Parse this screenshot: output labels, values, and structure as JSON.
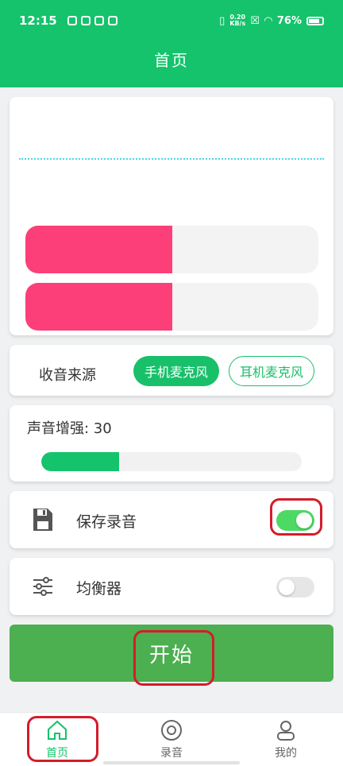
{
  "status_bar": {
    "time": "12:15",
    "net_speed_value": "0.20",
    "net_speed_unit": "KB/s",
    "battery": "76%"
  },
  "header": {
    "title": "首页"
  },
  "level_meters": [
    {
      "level_fraction": 0.5
    },
    {
      "level_fraction": 0.5
    }
  ],
  "source": {
    "label": "收音来源",
    "options": [
      {
        "label": "手机麦克风",
        "selected": true
      },
      {
        "label": "耳机麦克风",
        "selected": false
      }
    ]
  },
  "boost": {
    "label": "声音增强: 30",
    "value_fraction": 0.3
  },
  "save_recording": {
    "label": "保存录音",
    "on": true,
    "icon": "save-icon"
  },
  "equalizer": {
    "label": "均衡器",
    "on": false,
    "icon": "equalizer-icon"
  },
  "start_button": {
    "label": "开始"
  },
  "tabs": [
    {
      "label": "首页",
      "icon": "home-icon",
      "active": true
    },
    {
      "label": "录音",
      "icon": "record-icon",
      "active": false
    },
    {
      "label": "我的",
      "icon": "user-icon",
      "active": false
    }
  ],
  "colors": {
    "primary": "#14c36b",
    "meter": "#fc3f78",
    "button": "#4caf50",
    "annotation": "#d41c2a"
  }
}
